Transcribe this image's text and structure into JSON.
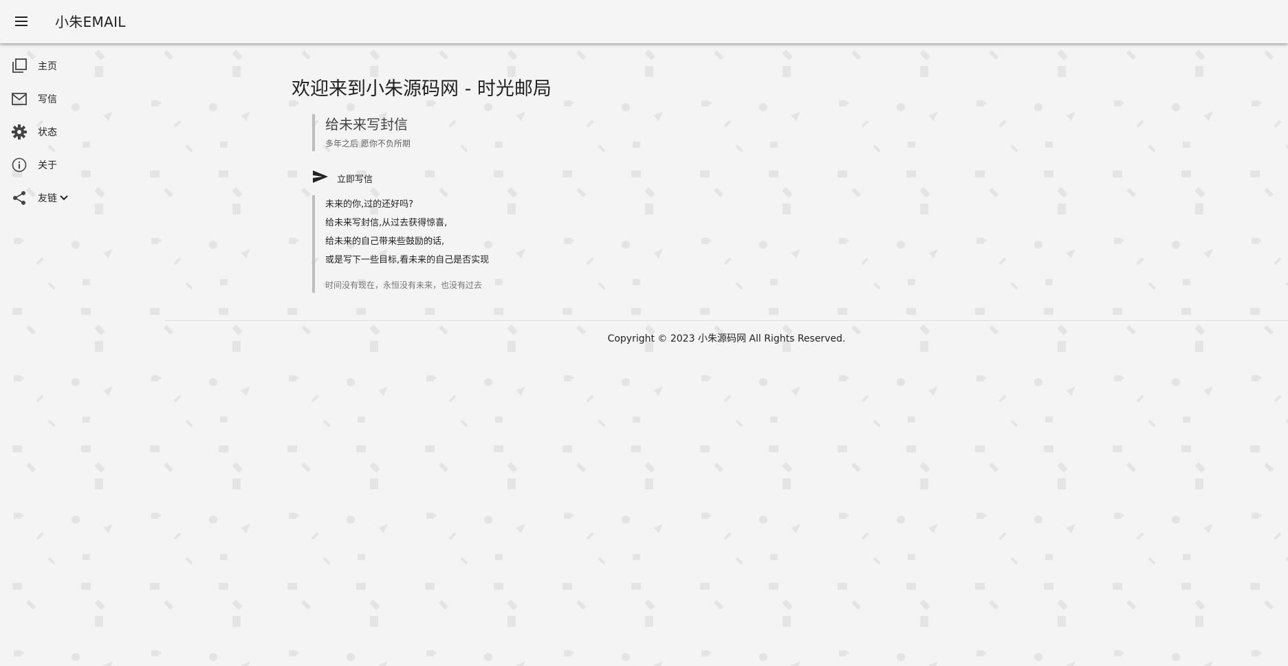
{
  "appbar": {
    "title": "小朱EMAIL",
    "menu_icon": "menu-icon"
  },
  "nav": {
    "items": [
      {
        "icon": "library-icon",
        "label": "主页"
      },
      {
        "icon": "mail-icon",
        "label": "写信"
      },
      {
        "icon": "gear-icon",
        "label": "状态"
      },
      {
        "icon": "info-icon",
        "label": "关于"
      },
      {
        "icon": "share-icon",
        "label": "友链",
        "expand_icon": "chevron-down-icon"
      }
    ]
  },
  "main": {
    "title": "欢迎来到小朱源码网 - 时光邮局",
    "quote": {
      "title": "给未来写封信",
      "subtitle": "多年之后 愿你不负所期"
    },
    "write_button": {
      "icon": "send-icon",
      "label": "立即写信"
    },
    "poem": {
      "lines": [
        "未来的你,过的还好吗?",
        "给未来写封信,从过去获得惊喜,",
        "给未来的自己带来些鼓励的话,",
        "或是写下一些目标,看未来的自己是否实现"
      ],
      "footer": "时间没有现在，永恒没有未来，也没有过去"
    }
  },
  "footer": {
    "copyright": "Copyright © 2023 小朱源码网 All Rights Reserved."
  },
  "colors": {
    "background": "#f4f4f4",
    "appbar": "#f5f5f5",
    "text": "#212121",
    "quote_border": "#bdbdbd",
    "pattern_icon": "#e6e6e6"
  }
}
